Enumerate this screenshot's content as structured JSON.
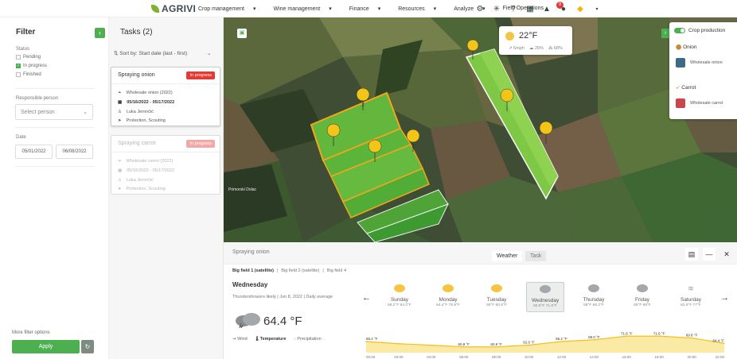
{
  "brand": {
    "name": "AGRIVI"
  },
  "nav": {
    "items": [
      "Crop management",
      "Wine management",
      "Finance",
      "Resources",
      "Analyze",
      "Field Operations"
    ],
    "dropdowns": [
      "▾",
      "▾",
      "▾",
      "▾",
      "▾",
      ""
    ]
  },
  "topbar": {
    "notification_count": "9"
  },
  "filter": {
    "title": "Filter",
    "status_label": "Status",
    "statuses": [
      {
        "label": "Pending",
        "checked": false
      },
      {
        "label": "In progress",
        "checked": true
      },
      {
        "label": "Finished",
        "checked": false
      }
    ],
    "person_label": "Responsible person",
    "person_placeholder": "Select person",
    "date_label": "Date",
    "date_from": "05/01/2022",
    "date_to": "06/08/2022",
    "more_label": "More filter options",
    "apply_label": "Apply"
  },
  "tasks": {
    "title": "Tasks (2)",
    "sort_label": "Sort by: Start date (last - first)",
    "items": [
      {
        "title": "Spraying onion",
        "status": "In progress",
        "crop": "Wholesale onion (2022)",
        "dates": "05/16/2022 - 05/17/2022",
        "person": "Luka Jerončić",
        "type": "Protection, Scouting"
      },
      {
        "title": "Spraying carrot",
        "status": "In progress",
        "crop": "Wholesale carrot (2022)",
        "dates": "05/16/2022 - 05/17/2022",
        "person": "Luka Jerončić",
        "type": "Protection, Scouting"
      }
    ]
  },
  "map": {
    "weather": {
      "temp": "22°F",
      "wind": "6mph",
      "humidity": "25%",
      "precip": "68%"
    },
    "place_label": "Primorski Dolac",
    "pin_labels": [
      "2",
      "2"
    ],
    "legend": {
      "toggle_label": "Crop production",
      "groups": [
        {
          "crop": "Onion",
          "item": "Wholesale onion",
          "color": "#3d6b86"
        },
        {
          "crop": "Carrot",
          "item": "Wholesale carrot",
          "color": "#c9464a"
        }
      ]
    }
  },
  "bottom": {
    "title": "Spraying onion",
    "tabs": [
      "Weather",
      "Task"
    ],
    "fields": [
      "Big field 1 (satellite)",
      "Big field 2 (satellite)",
      "Big field 4"
    ],
    "day": "Wednesday",
    "summary": "Thundershowers likely  |  Jun 8, 2022  |  Daily average",
    "current_temp": "64.4 °F",
    "metrics": [
      "Wind",
      "Temperature",
      "Precipitation"
    ],
    "forecast": [
      {
        "day": "Sunday",
        "range": "66.2°F 84.2°F",
        "icon": "sun"
      },
      {
        "day": "Monday",
        "range": "64.4°F 78.8°F",
        "icon": "sun"
      },
      {
        "day": "Tuesday",
        "range": "59°F 80.6°F",
        "icon": "sun"
      },
      {
        "day": "Wednesday",
        "range": "60.8°F 71.6°F",
        "icon": "storm",
        "selected": true
      },
      {
        "day": "Thursday",
        "range": "59°F 66.2°F",
        "icon": "storm"
      },
      {
        "day": "Friday",
        "range": "59°F 68°F",
        "icon": "storm"
      },
      {
        "day": "Saturday",
        "range": "62.6°F 77°F",
        "icon": "wind"
      }
    ],
    "chart": {
      "times": [
        "00:00",
        "02:00",
        "04:00",
        "06:00",
        "08:00",
        "10:00",
        "12:00",
        "14:00",
        "16:00",
        "18:00",
        "20:00",
        "22:00"
      ],
      "values": [
        66.2,
        64.0,
        62.5,
        60.8,
        60.8,
        62.6,
        66.2,
        68.0,
        71.6,
        71.6,
        69.8,
        64.4
      ],
      "labels": [
        "66.2 °F",
        "",
        "",
        "60.8 °F",
        "60.8 °F",
        "62.6 °F",
        "66.2 °F",
        "68.0 °F",
        "71.6 °F",
        "71.6 °F",
        "69.8 °F",
        "64.4 °F"
      ],
      "ylim": [
        55,
        75
      ],
      "color": "#f3c01a"
    }
  }
}
